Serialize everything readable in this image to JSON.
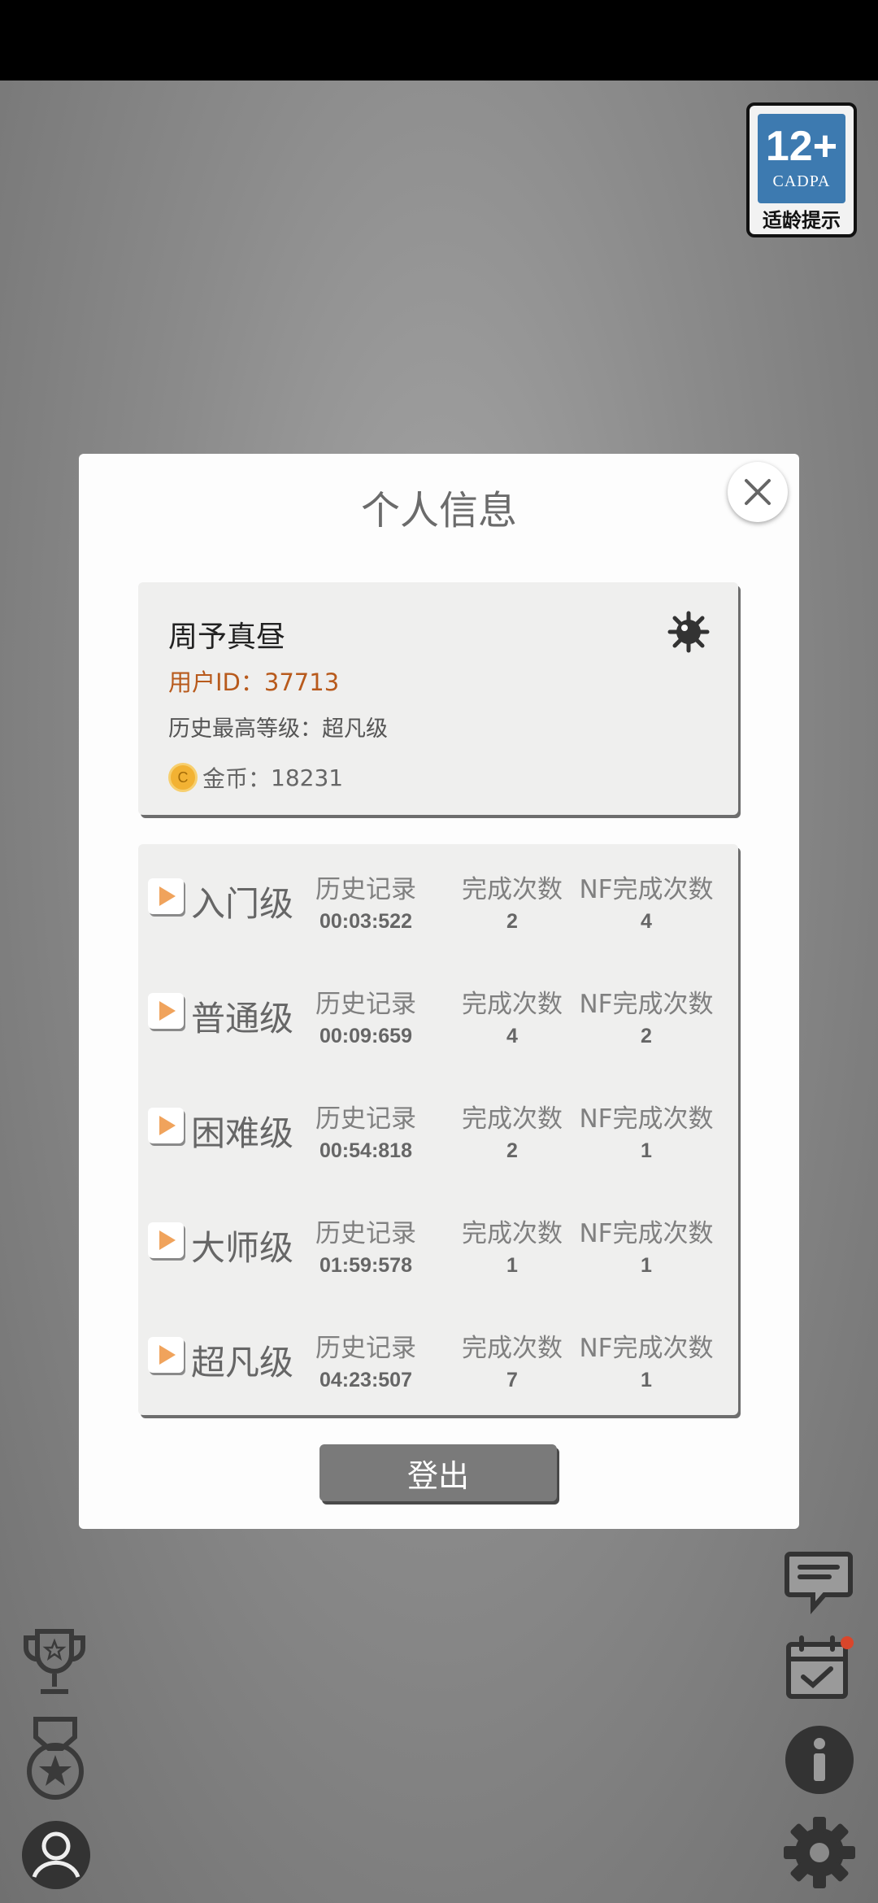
{
  "age_rating": {
    "age": "12+",
    "org": "CADPA",
    "tip": "适龄提示"
  },
  "dialog": {
    "title": "个人信息",
    "user": {
      "name": "周予真昼",
      "id_label": "用户ID：",
      "id_value": "37713",
      "best_level_label": "历史最高等级：",
      "best_level_value": "超凡级",
      "coin_symbol": "C",
      "coins_label": "金币：",
      "coins_value": "18231"
    },
    "levels": [
      {
        "name": "入门级",
        "hist_label": "历史记录",
        "hist_value": "00:03:522",
        "done_label": "完成次数",
        "done_value": "2",
        "nf_label": "NF完成次数",
        "nf_value": "4"
      },
      {
        "name": "普通级",
        "hist_label": "历史记录",
        "hist_value": "00:09:659",
        "done_label": "完成次数",
        "done_value": "4",
        "nf_label": "NF完成次数",
        "nf_value": "2"
      },
      {
        "name": "困难级",
        "hist_label": "历史记录",
        "hist_value": "00:54:818",
        "done_label": "完成次数",
        "done_value": "2",
        "nf_label": "NF完成次数",
        "nf_value": "1"
      },
      {
        "name": "大师级",
        "hist_label": "历史记录",
        "hist_value": "01:59:578",
        "done_label": "完成次数",
        "done_value": "1",
        "nf_label": "NF完成次数",
        "nf_value": "1"
      },
      {
        "name": "超凡级",
        "hist_label": "历史记录",
        "hist_value": "04:23:507",
        "done_label": "完成次数",
        "done_value": "7",
        "nf_label": "NF完成次数",
        "nf_value": "1"
      }
    ],
    "logout_label": "登出"
  },
  "icons": {
    "left": [
      "trophy-icon",
      "medal-icon",
      "profile-icon"
    ],
    "right": [
      "chat-icon",
      "calendar-check-icon",
      "info-icon",
      "settings-gear-icon"
    ]
  },
  "colors": {
    "accent_orange": "#b85a1c",
    "card_bg": "#efefee",
    "notification_dot": "#d9462b"
  }
}
